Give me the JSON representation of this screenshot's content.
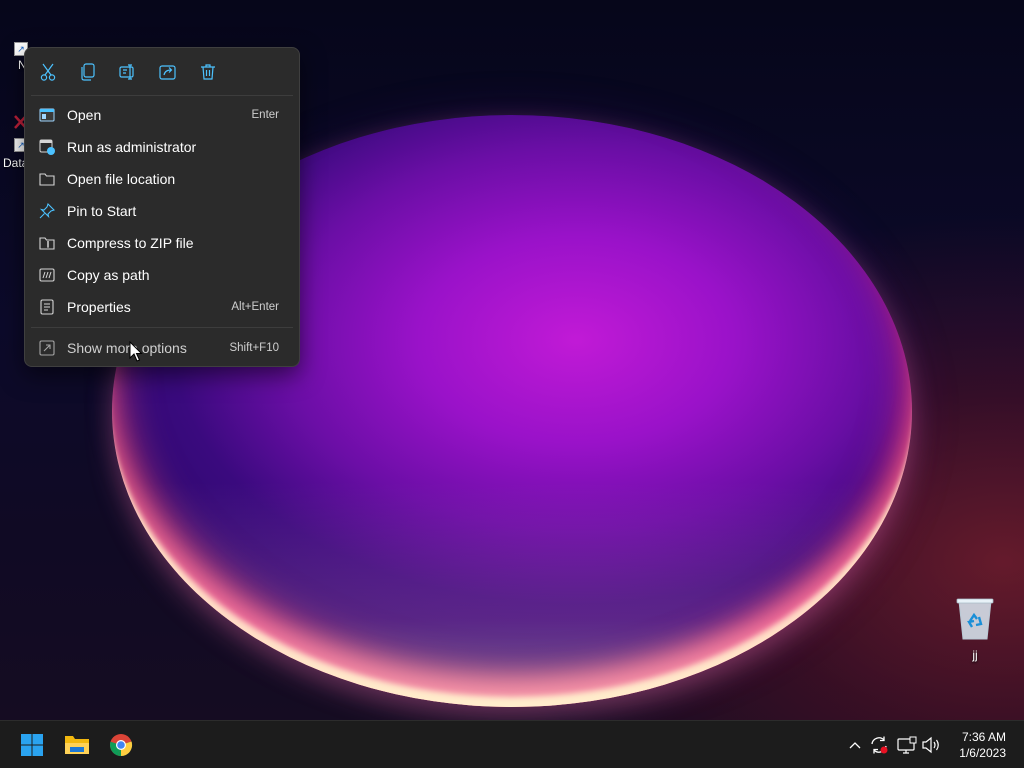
{
  "desktop": {
    "icons": [
      {
        "id": "nvidia",
        "label": "N G"
      },
      {
        "id": "data",
        "label": "Data"
      }
    ],
    "recycle_bin": {
      "label": "jj"
    }
  },
  "context_menu": {
    "toolbar": [
      {
        "name": "cut-icon",
        "title": "Cut"
      },
      {
        "name": "copy-icon",
        "title": "Copy"
      },
      {
        "name": "rename-icon",
        "title": "Rename"
      },
      {
        "name": "share-icon",
        "title": "Share"
      },
      {
        "name": "delete-icon",
        "title": "Delete"
      }
    ],
    "items": [
      {
        "label": "Open",
        "shortcut": "Enter",
        "icon": "open-icon"
      },
      {
        "label": "Run as administrator",
        "shortcut": "",
        "icon": "shield-icon"
      },
      {
        "label": "Open file location",
        "shortcut": "",
        "icon": "folder-icon"
      },
      {
        "label": "Pin to Start",
        "shortcut": "",
        "icon": "pin-icon"
      },
      {
        "label": "Compress to ZIP file",
        "shortcut": "",
        "icon": "zip-folder-icon"
      },
      {
        "label": "Copy as path",
        "shortcut": "",
        "icon": "copy-path-icon"
      },
      {
        "label": "Properties",
        "shortcut": "Alt+Enter",
        "icon": "properties-icon"
      }
    ],
    "more": {
      "label": "Show more options",
      "shortcut": "Shift+F10",
      "icon": "more-options-icon"
    }
  },
  "taskbar": {
    "apps": [
      {
        "name": "start-button",
        "icon": "windows-logo-icon"
      },
      {
        "name": "file-explorer-button",
        "icon": "folder-icon"
      },
      {
        "name": "chrome-button",
        "icon": "chrome-icon"
      }
    ],
    "tray": [
      {
        "name": "show-hidden-icons-button",
        "icon": "chevron-up-icon"
      },
      {
        "name": "sync-status-icon",
        "icon": "sync-icon"
      },
      {
        "name": "network-icon",
        "icon": "network-icon"
      },
      {
        "name": "volume-icon",
        "icon": "speaker-icon"
      }
    ],
    "clock": {
      "time": "7:36 AM",
      "date": "1/6/2023"
    }
  },
  "colors": {
    "menu_bg": "#2b2b2b",
    "taskbar_bg": "#1c1c1c",
    "accent": "#4cc2ff",
    "nvidia_green": "#76b900"
  }
}
